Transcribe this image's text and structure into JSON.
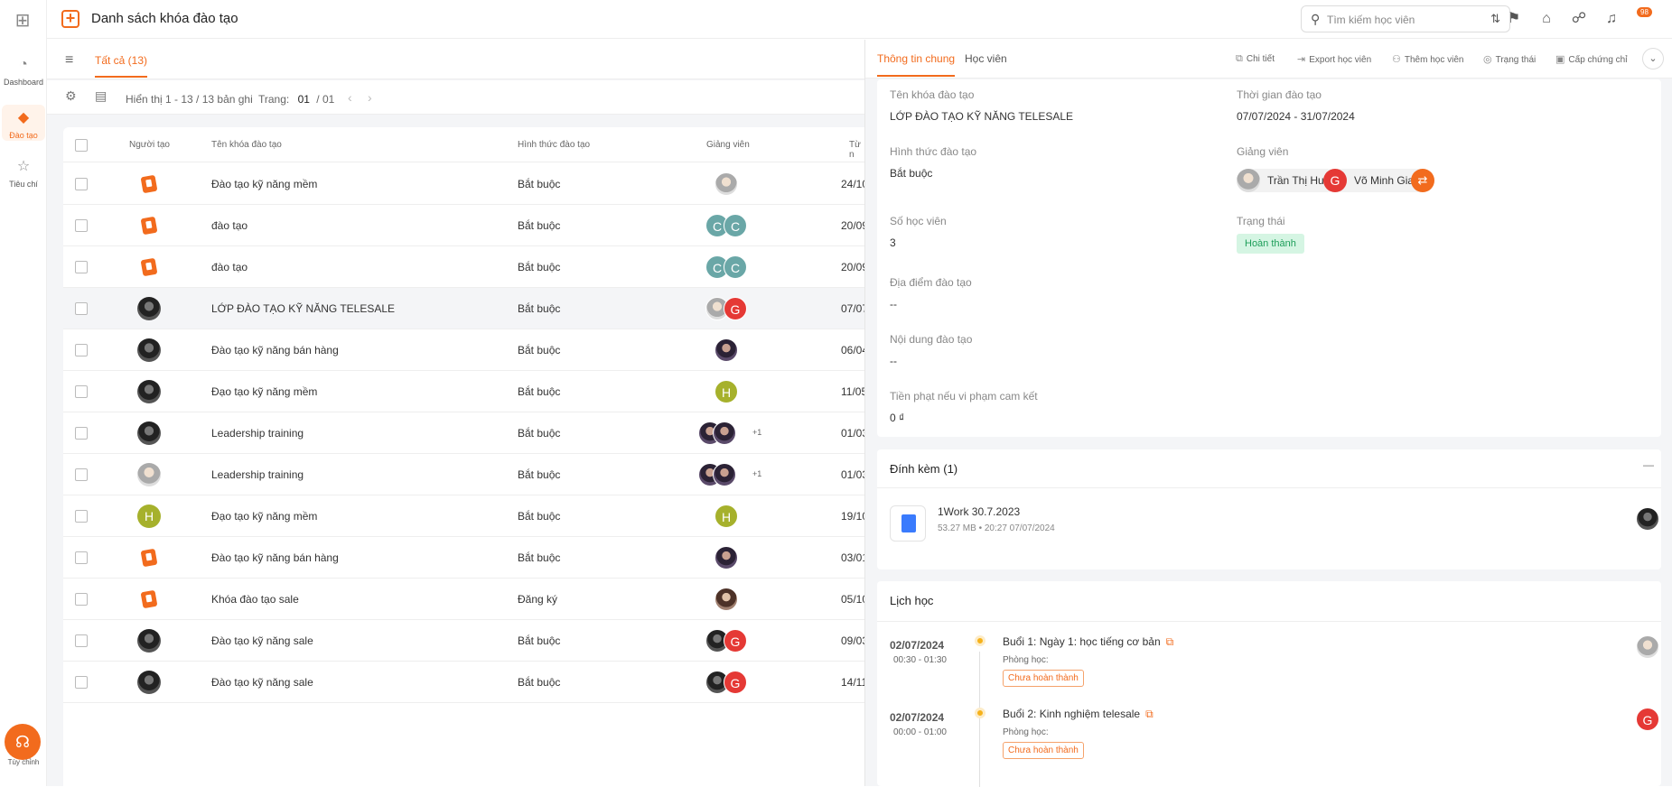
{
  "app": {
    "title": "Danh sách khóa đào tạo",
    "notification_count": "98"
  },
  "sidebar": {
    "items": [
      {
        "label": "Dashboard",
        "icon": "chart-icon"
      },
      {
        "label": "Đào tạo",
        "icon": "graduation-icon",
        "active": true
      },
      {
        "label": "Tiêu chí",
        "icon": "star-icon"
      }
    ],
    "support_label": "Tùy chỉnh"
  },
  "search": {
    "placeholder": "Tìm kiếm học viên"
  },
  "list": {
    "tab_all": "Tất cả (13)",
    "info": "Hiển thị 1 - 13 / 13 bản ghi",
    "page_label": "Trang:",
    "page_current": "01",
    "page_total": "/ 01",
    "columns": {
      "creator": "Người tạo",
      "name": "Tên khóa đào tạo",
      "type": "Hình thức đào tạo",
      "lecturer": "Giảng viên",
      "from": "Từ n"
    },
    "rows": [
      {
        "name": "Đào tạo kỹ năng mềm",
        "type": "Bắt buộc",
        "date": "24/10"
      },
      {
        "name": "đào tạo",
        "type": "Bắt buộc",
        "date": "20/09"
      },
      {
        "name": "đào tạo",
        "type": "Bắt buộc",
        "date": "20/09"
      },
      {
        "name": "LỚP ĐÀO TẠO KỸ NĂNG TELESALE",
        "type": "Bắt buộc",
        "date": "07/07"
      },
      {
        "name": "Đào tạo kỹ năng bán hàng",
        "type": "Bắt buộc",
        "date": "06/04"
      },
      {
        "name": "Đạo tạo kỹ năng mềm",
        "type": "Bắt buộc",
        "date": "11/05"
      },
      {
        "name": "Leadership training",
        "type": "Bắt buộc",
        "date": "01/03"
      },
      {
        "name": "Leadership training",
        "type": "Bắt buộc",
        "date": "01/03"
      },
      {
        "name": "Đạo tạo kỹ năng mềm",
        "type": "Bắt buộc",
        "date": "19/10"
      },
      {
        "name": "Đào tạo kỹ năng bán hàng",
        "type": "Bắt buộc",
        "date": "03/01"
      },
      {
        "name": "Khóa đào tạo sale",
        "type": "Đăng ký",
        "date": "05/10"
      },
      {
        "name": "Đào tạo kỹ năng sale",
        "type": "Bắt buộc",
        "date": "09/03"
      },
      {
        "name": "Đào tạo kỹ năng sale",
        "type": "Bắt buộc",
        "date": "14/11"
      }
    ],
    "letters": {
      "c": "C",
      "g": "G",
      "h": "H"
    },
    "more_count": "+1"
  },
  "detail": {
    "tabs": [
      "Thông tin chung",
      "Học viên"
    ],
    "actions": [
      "Chi tiết",
      "Export học viên",
      "Thêm học viên",
      "Trạng thái",
      "Cấp chứng chỉ"
    ],
    "fields": {
      "course_name_label": "Tên khóa đào tạo",
      "course_name": "LỚP ĐÀO TẠO KỸ NĂNG TELESALE",
      "time_label": "Thời gian đào tạo",
      "time": "07/07/2024 - 31/07/2024",
      "type_label": "Hình thức đào tạo",
      "type": "Bắt buộc",
      "lecturer_label": "Giảng viên",
      "lecturers": [
        "Trần Thị Huệ",
        "Võ Minh Giang"
      ],
      "students_label": "Số học viên",
      "students": "3",
      "status_label": "Trạng thái",
      "status": "Hoàn thành",
      "location_label": "Địa điểm đào tạo",
      "location": "--",
      "content_label": "Nội dung đào tạo",
      "content": "--",
      "penalty_label": "Tiền phạt nếu vi phạm cam kết",
      "penalty": "0 ₫"
    },
    "attachments": {
      "title": "Đính kèm (1)",
      "collapse": "—",
      "file_name": "1Work 30.7.2023",
      "file_size": "53.27 MB",
      "file_time": "20:27 07/07/2024"
    },
    "schedule": {
      "title": "Lịch học",
      "room_label": "Phòng học:",
      "sessions": [
        {
          "date": "02/07/2024",
          "time": "00:30 - 01:30",
          "title": "Buổi 1: Ngày 1: học tiếng cơ bản",
          "status": "Chưa hoàn thành"
        },
        {
          "date": "02/07/2024",
          "time": "00:00 - 01:00",
          "title": "Buổi 2: Kinh nghiệm telesale",
          "status": "Chưa hoàn thành"
        }
      ]
    }
  }
}
